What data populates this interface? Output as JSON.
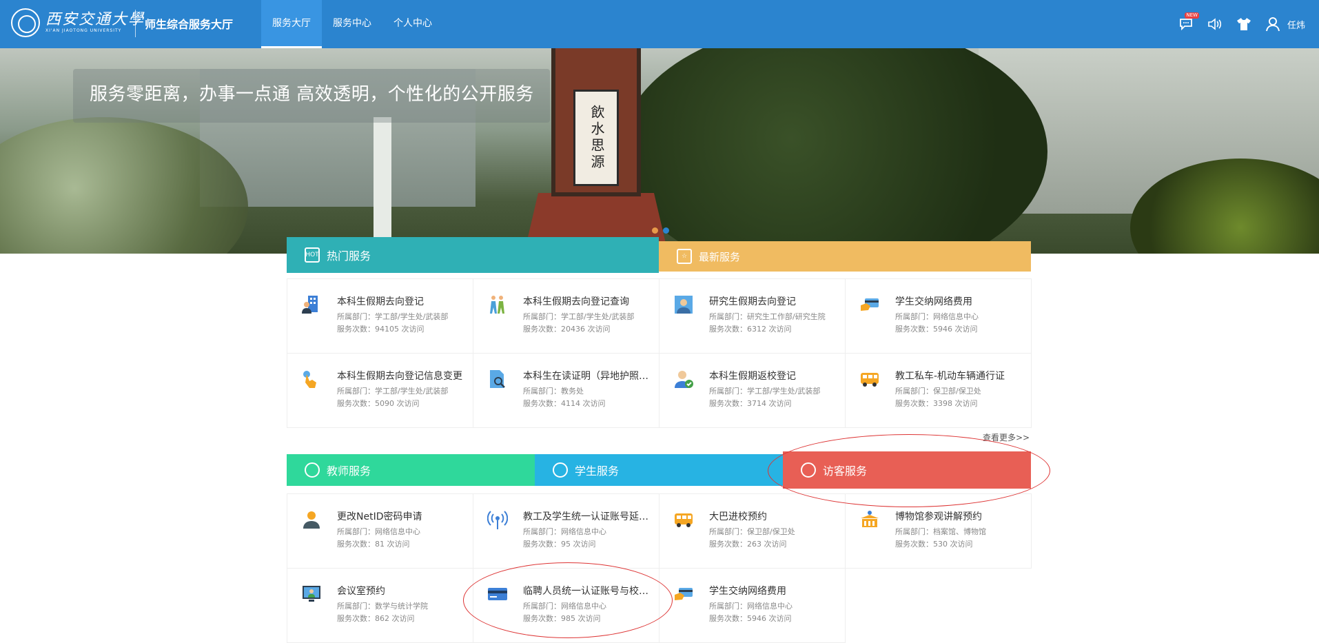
{
  "header": {
    "logo_cn": "西安交通大學",
    "logo_en": "XI'AN JIAOTONG UNIVERSITY",
    "site_title": "师生综合服务大厅",
    "nav": [
      "服务大厅",
      "服务中心",
      "个人中心"
    ],
    "new_badge": "NEW",
    "username": "任炜"
  },
  "banner": {
    "caption": "服务零距离，办事一点通 高效透明，个性化的公开服务",
    "monument_text": "飲水思源"
  },
  "tabs_top": {
    "hot": "热门服务",
    "new": "最新服务",
    "hot_icon_text": "HOT"
  },
  "labels": {
    "dept_prefix": "所属部门：",
    "visits_prefix": "服务次数：",
    "visits_suffix": " 次访问"
  },
  "hot_services": [
    {
      "name": "本科生假期去向登记",
      "dept": "所属部门：学工部/学生处/武装部",
      "visits": "服务次数：94105 次访问",
      "icon": "building-person-icon"
    },
    {
      "name": "本科生假期去向登记查询",
      "dept": "所属部门：学工部/学生处/武装部",
      "visits": "服务次数：20436 次访问",
      "icon": "walking-people-icon"
    },
    {
      "name": "研究生假期去向登记",
      "dept": "所属部门：研究生工作部/研究生院",
      "visits": "服务次数：6312 次访问",
      "icon": "person-portrait-icon"
    },
    {
      "name": "学生交纳网络费用",
      "dept": "所属部门：网络信息中心",
      "visits": "服务次数：5946 次访问",
      "icon": "card-payment-icon"
    },
    {
      "name": "本科生假期去向登记信息变更",
      "dept": "所属部门：学工部/学生处/武装部",
      "visits": "服务次数：5090 次访问",
      "icon": "hand-pointer-icon"
    },
    {
      "name": "本科生在读证明（异地护照办理）",
      "dept": "所属部门：教务处",
      "visits": "服务次数：4114 次访问",
      "icon": "document-search-icon"
    },
    {
      "name": "本科生假期返校登记",
      "dept": "所属部门：学工部/学生处/武装部",
      "visits": "服务次数：3714 次访问",
      "icon": "person-check-icon"
    },
    {
      "name": "教工私车-机动车辆通行证",
      "dept": "所属部门：保卫部/保卫处",
      "visits": "服务次数：3398 次访问",
      "icon": "bus-icon"
    }
  ],
  "more_link": "查看更多>>",
  "tabs_bottom": {
    "teacher": "教师服务",
    "student": "学生服务",
    "visitor": "访客服务"
  },
  "visitor_services": [
    {
      "name": "更改NetID密码申请",
      "dept": "所属部门：网络信息中心",
      "visits": "服务次数：81 次访问",
      "icon": "user-silhouette-icon"
    },
    {
      "name": "教工及学生统一认证账号延期申请",
      "dept": "所属部门：网络信息中心",
      "visits": "服务次数：95 次访问",
      "icon": "broadcast-icon"
    },
    {
      "name": "大巴进校预约",
      "dept": "所属部门：保卫部/保卫处",
      "visits": "服务次数：263 次访问",
      "icon": "bus-icon"
    },
    {
      "name": "博物馆参观讲解预约",
      "dept": "所属部门：档案馆、博物馆",
      "visits": "服务次数：530 次访问",
      "icon": "museum-icon"
    },
    {
      "name": "会议室预约",
      "dept": "所属部门：数学与统计学院",
      "visits": "服务次数：862 次访问",
      "icon": "monitor-person-icon"
    },
    {
      "name": "临聘人员统一认证账号与校园卡申请",
      "dept": "所属部门：网络信息中心",
      "visits": "服务次数：985 次访问",
      "icon": "card-icon"
    },
    {
      "name": "学生交纳网络费用",
      "dept": "所属部门：网络信息中心",
      "visits": "服务次数：5946 次访问",
      "icon": "card-payment-icon"
    }
  ],
  "colors": {
    "header": "#2b84cf",
    "hot_tab": "#2fb0b5",
    "new_tab": "#f0bb61",
    "teacher_tab": "#2fd89b",
    "student_tab": "#27b3e3",
    "visitor_tab": "#e85f55",
    "annotation": "#dd3333"
  }
}
